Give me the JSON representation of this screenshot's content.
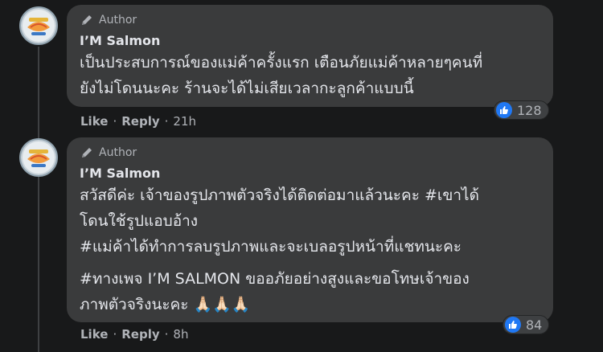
{
  "comments": [
    {
      "badge": "Author",
      "name": "I’M Salmon",
      "lines": [
        "เป็นประสบการณ์ของแม่ค้าครั้งแรก เตือนภัยแม่ค้าหลายๆคนที่",
        "ยังไม่โดนนะคะ ร้านจะได้ไม่เสียเวลากะลูกค้าแบบนี้"
      ],
      "reaction_count": "128",
      "like_label": "Like",
      "reply_label": "Reply",
      "time": "21h"
    },
    {
      "badge": "Author",
      "name": "I’M Salmon",
      "lines": [
        "สวัสดีค่ะ เจ้าของรูปภาพตัวจริงได้ติดต่อมาแล้วนะคะ #เขาได้",
        "โดนใช้รูปแอบอ้าง",
        "#แม่ค้าได้ทำการลบรูปภาพและจะเบลอรูปหน้าที่แชทนะคะ"
      ],
      "lines2": [
        "#ทางเพจ I’M SALMON ขออภัยอย่างสูงและขอโทษเจ้าของ",
        "ภาพตัวจริงนะคะ 🙏🏻🙏🏻🙏🏻"
      ],
      "reaction_count": "84",
      "like_label": "Like",
      "reply_label": "Reply",
      "time": "8h"
    }
  ],
  "colors": {
    "background": "#18191a",
    "bubble": "#3a3b3c",
    "like_blue": "#2078f4",
    "secondary_text": "#b0b3b8"
  },
  "icons": {
    "badge": "pencil-icon",
    "reaction": "like-icon"
  }
}
